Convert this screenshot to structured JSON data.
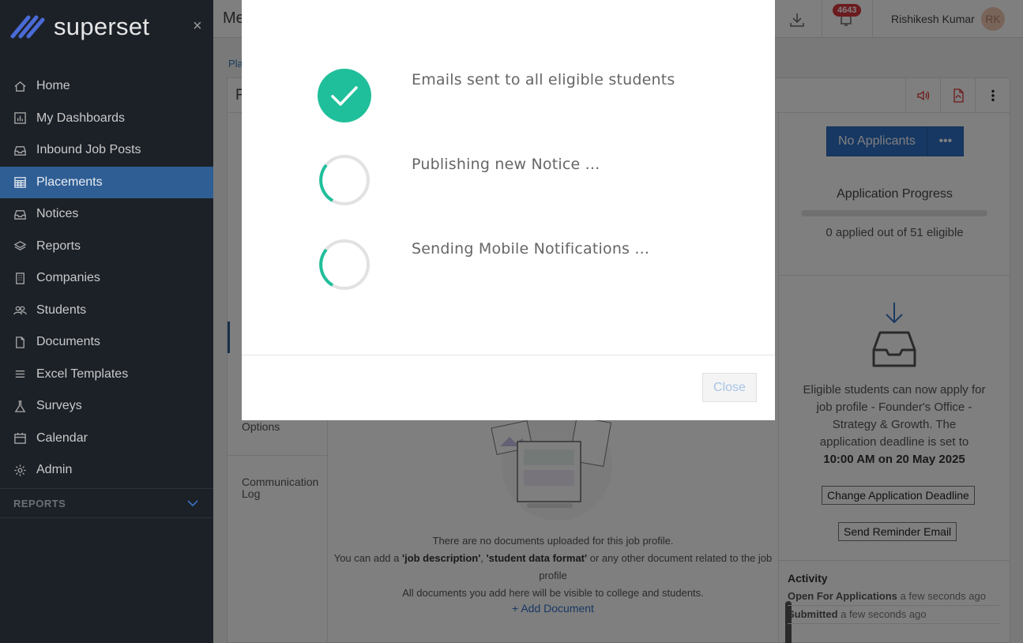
{
  "app": {
    "brand": "superset",
    "close_glyph": "×"
  },
  "sidebar": {
    "items": [
      {
        "label": "Home",
        "icon": "home-icon"
      },
      {
        "label": "My Dashboards",
        "icon": "bar-chart-icon"
      },
      {
        "label": "Inbound Job Posts",
        "icon": "inbox-icon"
      },
      {
        "label": "Placements",
        "icon": "calendar-grid-icon",
        "active": true
      },
      {
        "label": "Notices",
        "icon": "inbox-icon"
      },
      {
        "label": "Reports",
        "icon": "layers-icon"
      },
      {
        "label": "Companies",
        "icon": "building-icon"
      },
      {
        "label": "Students",
        "icon": "users-icon"
      },
      {
        "label": "Documents",
        "icon": "file-icon"
      },
      {
        "label": "Excel Templates",
        "icon": "menu-icon"
      },
      {
        "label": "Surveys",
        "icon": "flask-icon"
      },
      {
        "label": "Calendar",
        "icon": "calendar-icon"
      },
      {
        "label": "Admin",
        "icon": "gear-icon"
      }
    ],
    "section_label": "REPORTS"
  },
  "topbar": {
    "title_partial": "Me",
    "notification_count": "4643",
    "user_name": "Rishikesh Kumar",
    "user_initials": "RK"
  },
  "breadcrumb": {
    "partial": "Pla"
  },
  "card": {
    "title_partial": "F",
    "left_tabs": {
      "options": "Options",
      "communication_log": "Communication Log"
    }
  },
  "right_panel": {
    "status_button": "No Applicants",
    "more_glyph": "•••",
    "progress_title": "Application Progress",
    "progress_fraction": 0,
    "progress_text": "0 applied out of 51 eligible",
    "eligible_text": "Eligible students can now apply for job profile - Founder's Office - Strategy & Growth. The application deadline is set to",
    "deadline": "10:00 AM on 20 May 2025",
    "change_deadline_button": "Change Application Deadline",
    "reminder_button": "Send Reminder Email",
    "activity_title": "Activity",
    "activity": [
      {
        "event": "Open For Applications",
        "time": "a few seconds ago"
      },
      {
        "event": "Submitted",
        "time": "a few seconds ago"
      }
    ]
  },
  "documents": {
    "empty_line1": "There are no documents uploaded for this job profile.",
    "empty_line2_a": "You can add a ",
    "empty_line2_b": "'job description'",
    "empty_line2_c": ", ",
    "empty_line2_d": "'student data format'",
    "empty_line2_e": " or any other document related to the job profile",
    "empty_line3": "All documents you add here will be visible to college and students.",
    "add_label": "Add Document",
    "add_glyph": "+"
  },
  "modal": {
    "steps": [
      {
        "label": "Emails sent to all eligible students",
        "status": "done"
      },
      {
        "label": "Publishing new Notice ...",
        "status": "loading"
      },
      {
        "label": "Sending Mobile Notifications ...",
        "status": "loading"
      }
    ],
    "close_label": "Close",
    "colors": {
      "success": "#20bf9b",
      "spinner": "#20bf9b",
      "track": "#e2e2e2"
    }
  }
}
